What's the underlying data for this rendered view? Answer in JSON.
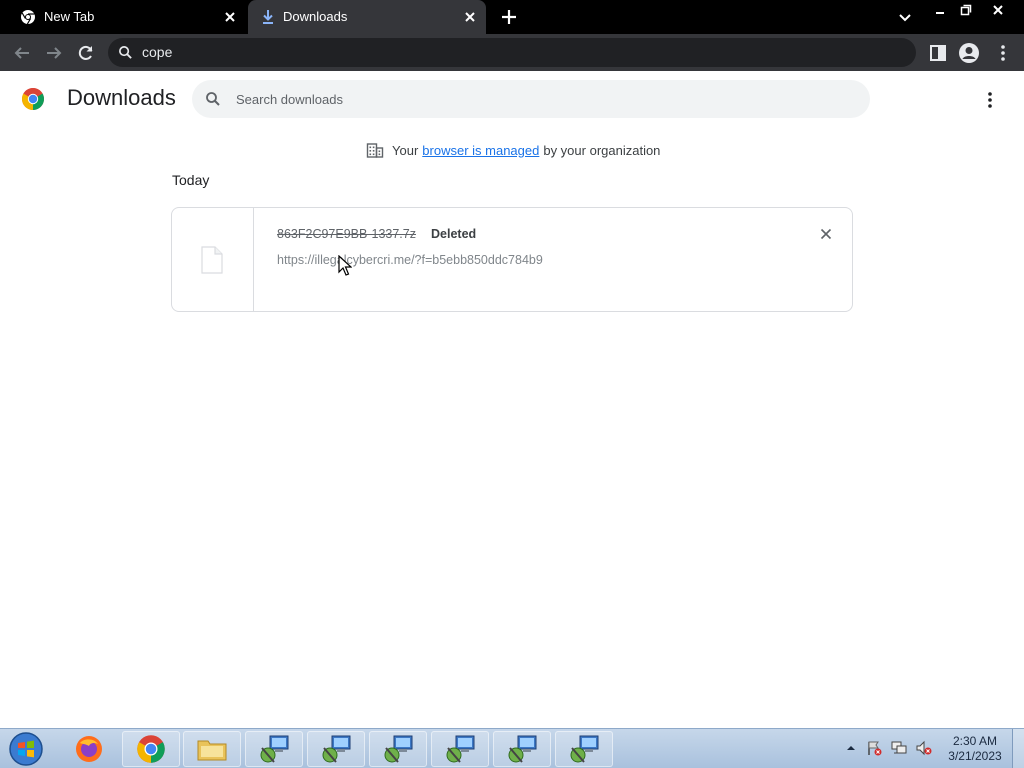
{
  "tabs": [
    {
      "title": "New Tab",
      "active": false,
      "icon": "chrome-icon"
    },
    {
      "title": "Downloads",
      "active": true,
      "icon": "download-icon"
    }
  ],
  "toolbar": {
    "omnibox_text": "cope"
  },
  "page": {
    "title": "Downloads",
    "search_placeholder": "Search downloads",
    "managed": {
      "prefix": "Your",
      "link": "browser is managed",
      "suffix": "by your organization"
    },
    "section_label": "Today",
    "downloads": [
      {
        "filename": "863F2C97E9BB-1337.7z",
        "status": "Deleted",
        "url": "https://illegalcybercri.me/?f=b5ebb850ddc784b9"
      }
    ]
  },
  "taskbar": {
    "time": "2:30 AM",
    "date": "3/21/2023"
  },
  "colors": {
    "tab_strip": "#000000",
    "toolbar": "#35363a",
    "link": "#1a73e8",
    "taskbar": "#b9cde4"
  }
}
